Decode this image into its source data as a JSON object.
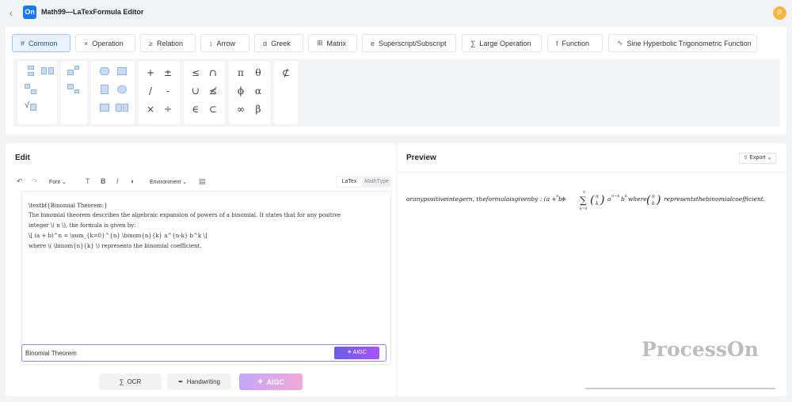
{
  "app": {
    "title": "Math99—LaTexFormula Editor",
    "logo": "On",
    "avatar": "P"
  },
  "tabs": [
    {
      "label": "Common",
      "icon": "#",
      "active": true
    },
    {
      "label": "Operation",
      "icon": "×"
    },
    {
      "label": "Relation",
      "icon": "≥"
    },
    {
      "label": "Arrow",
      "icon": "↕"
    },
    {
      "label": "Greek",
      "icon": "α"
    },
    {
      "label": "Matrix",
      "icon": "⊞"
    },
    {
      "label": "Superscript/Subscript",
      "icon": "e"
    },
    {
      "label": "Large Operation",
      "icon": "∑"
    },
    {
      "label": "Function",
      "icon": "f"
    },
    {
      "label": "Sine Hyperbolic Trigonometric Function",
      "icon": "∿"
    }
  ],
  "symbols": {
    "ops": [
      "+",
      "±",
      "/",
      "-",
      "×",
      "÷"
    ],
    "rel": [
      "≤",
      "∩",
      "∪",
      "≰",
      "∈",
      "⊂"
    ],
    "greek": [
      "π",
      "θ",
      "ϕ",
      "α",
      "∞",
      "β"
    ],
    "misc": [
      "⊄"
    ]
  },
  "edit": {
    "title": "Edit",
    "font_label": "Font",
    "environment_label": "Environment",
    "mode_latex": "LaTex",
    "mode_mathtype": "MathType",
    "code_lines": [
      "\\textbf{Binomial Theorem:}",
      "The binomial theorem describes the algebraic expansion of powers of a binomial. It states that for any positive",
      "integer \\( n \\), the formula is given by:",
      "\\[ (a + b)^n = \\sum_{k=0}^{n} \\binom{n}{k} a^{n-k} b^k \\]",
      "where \\( \\binom{n}{k} \\) represents the binomial coefficient."
    ],
    "aigc_input_value": "Binomial Theorem",
    "aigc_button": "AIGC",
    "ocr_button": "OCR",
    "handwriting_button": "Handwriting",
    "aigc_main_button": "AIGC"
  },
  "preview": {
    "title": "Preview",
    "export_label": "Export",
    "formula_prefix": "oranypositiveintegern, theformulaisgivenby : (a + b)",
    "formula_middle": "a",
    "formula_where": "where",
    "formula_suffix": "representsthebinomialcoefficient.",
    "watermark": "ProcessOn"
  }
}
